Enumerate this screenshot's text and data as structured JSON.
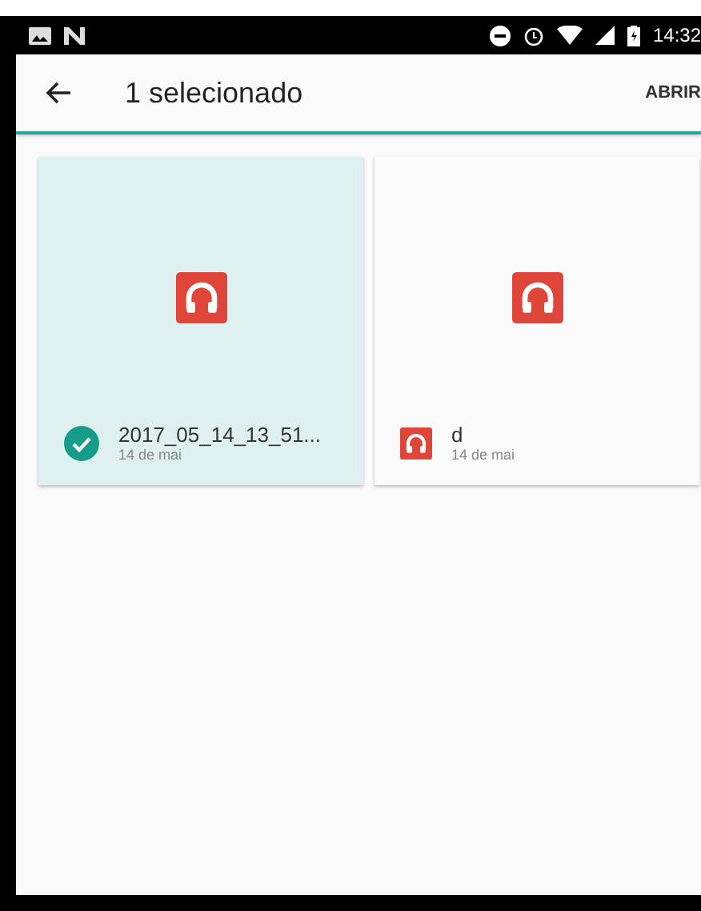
{
  "status_bar": {
    "time": "14:32"
  },
  "app_bar": {
    "title": "1 selecionado",
    "action": "ABRIR"
  },
  "files": [
    {
      "name": "2017_05_14_13_51...",
      "date": "14 de mai",
      "selected": true
    },
    {
      "name": "d",
      "date": "14 de mai",
      "selected": false
    }
  ]
}
